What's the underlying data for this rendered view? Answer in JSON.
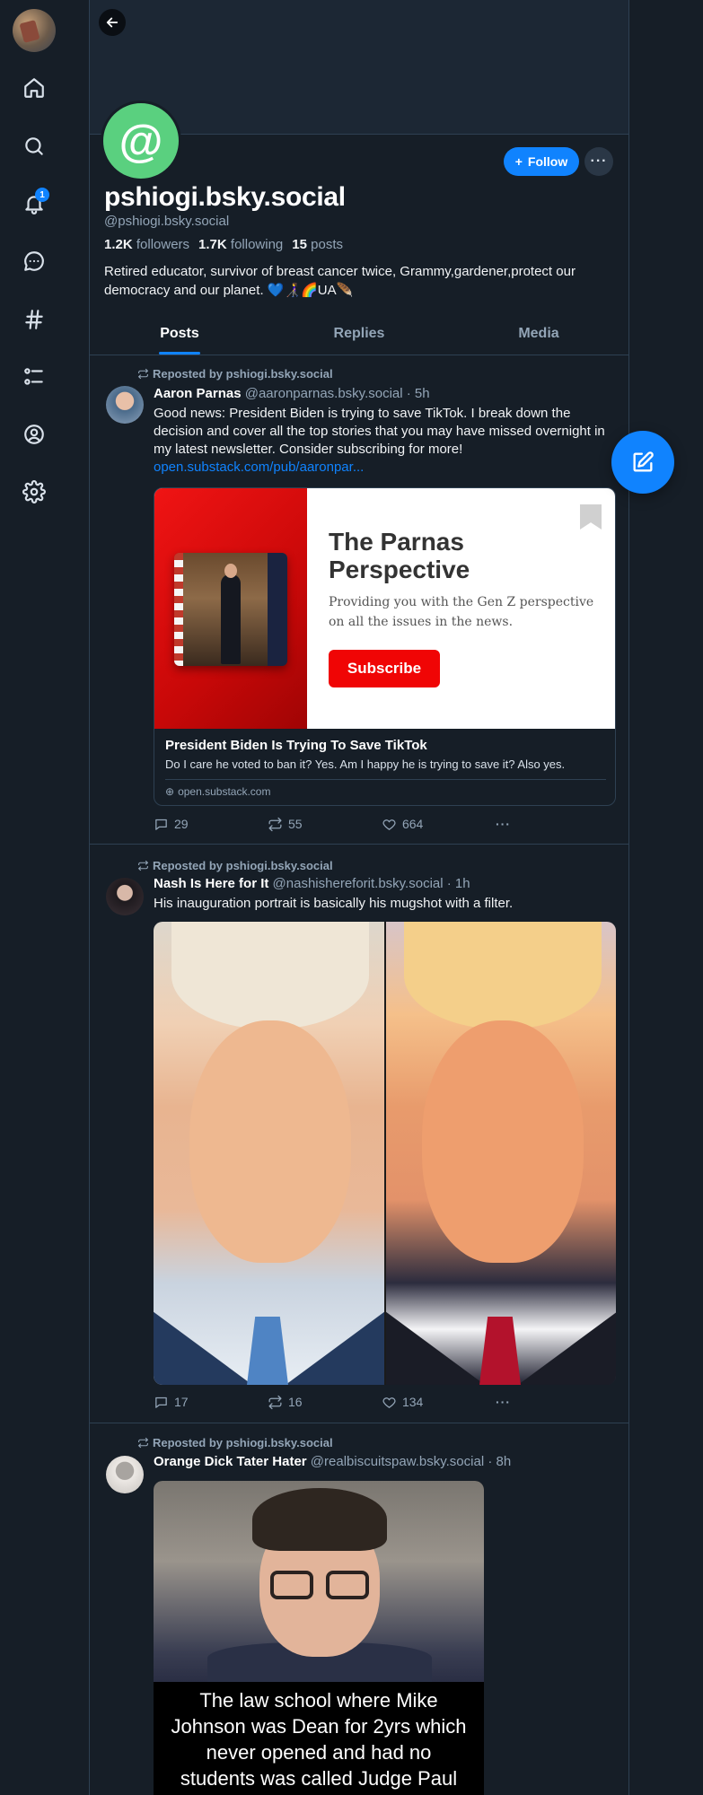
{
  "nav": {
    "notification_count": "1",
    "items": [
      "home-icon",
      "search-icon",
      "bell-icon",
      "chat-icon",
      "hashtag-icon",
      "list-icon",
      "profile-icon",
      "settings-icon"
    ]
  },
  "profile": {
    "avatar_glyph": "@",
    "avatar_color": "#5ad07f",
    "display_name": "pshiogi.bsky.social",
    "handle": "@pshiogi.bsky.social",
    "followers_count": "1.2K",
    "followers_label": "followers",
    "following_count": "1.7K",
    "following_label": "following",
    "posts_count": "15",
    "posts_label": "posts",
    "bio": "Retired educator, survivor of breast cancer twice, Grammy,gardener,protect our democracy and our planet. 💙👩‍🦯🌈UA🪶",
    "follow_label": "Follow",
    "more_label": "···"
  },
  "tabs": [
    "Posts",
    "Replies",
    "Media"
  ],
  "accent": "#1083fe",
  "posts": [
    {
      "repost_label": "Reposted by pshiogi.bsky.social",
      "author": "Aaron Parnas",
      "handle": "@aaronparnas.bsky.social",
      "time": "· 5h",
      "text": "Good news: President Biden is trying to save TikTok. I break down the decision and cover all the top stories that you may have missed overnight in my latest newsletter. Consider subscribing for more!",
      "link": "open.substack.com/pub/aaronpar...",
      "card": {
        "image_title": "The Parnas Perspective",
        "image_subtitle": "Providing you with the Gen Z perspective on all the issues in the news.",
        "image_button": "Subscribe",
        "title": "President Biden Is Trying To Save TikTok",
        "description": "Do I care he voted to ban it? Yes. Am I happy he is trying to save it? Also yes.",
        "domain": "open.substack.com"
      },
      "replies": "29",
      "reposts": "55",
      "likes": "664"
    },
    {
      "repost_label": "Reposted by pshiogi.bsky.social",
      "author": "Nash Is Here for It",
      "handle": "@nashishereforit.bsky.social",
      "time": "· 1h",
      "text": "His inauguration portrait is basically his mugshot with a filter.",
      "replies": "17",
      "reposts": "16",
      "likes": "134"
    },
    {
      "repost_label": "Reposted by pshiogi.bsky.social",
      "author": "Orange Dick Tater Hater",
      "handle": "@realbiscuitspaw.bsky.social",
      "time": "· 8h",
      "image_caption": "The law school where Mike Johnson was Dean for 2yrs which never opened and had no students was called Judge Paul Pressler School of Law. The"
    }
  ]
}
